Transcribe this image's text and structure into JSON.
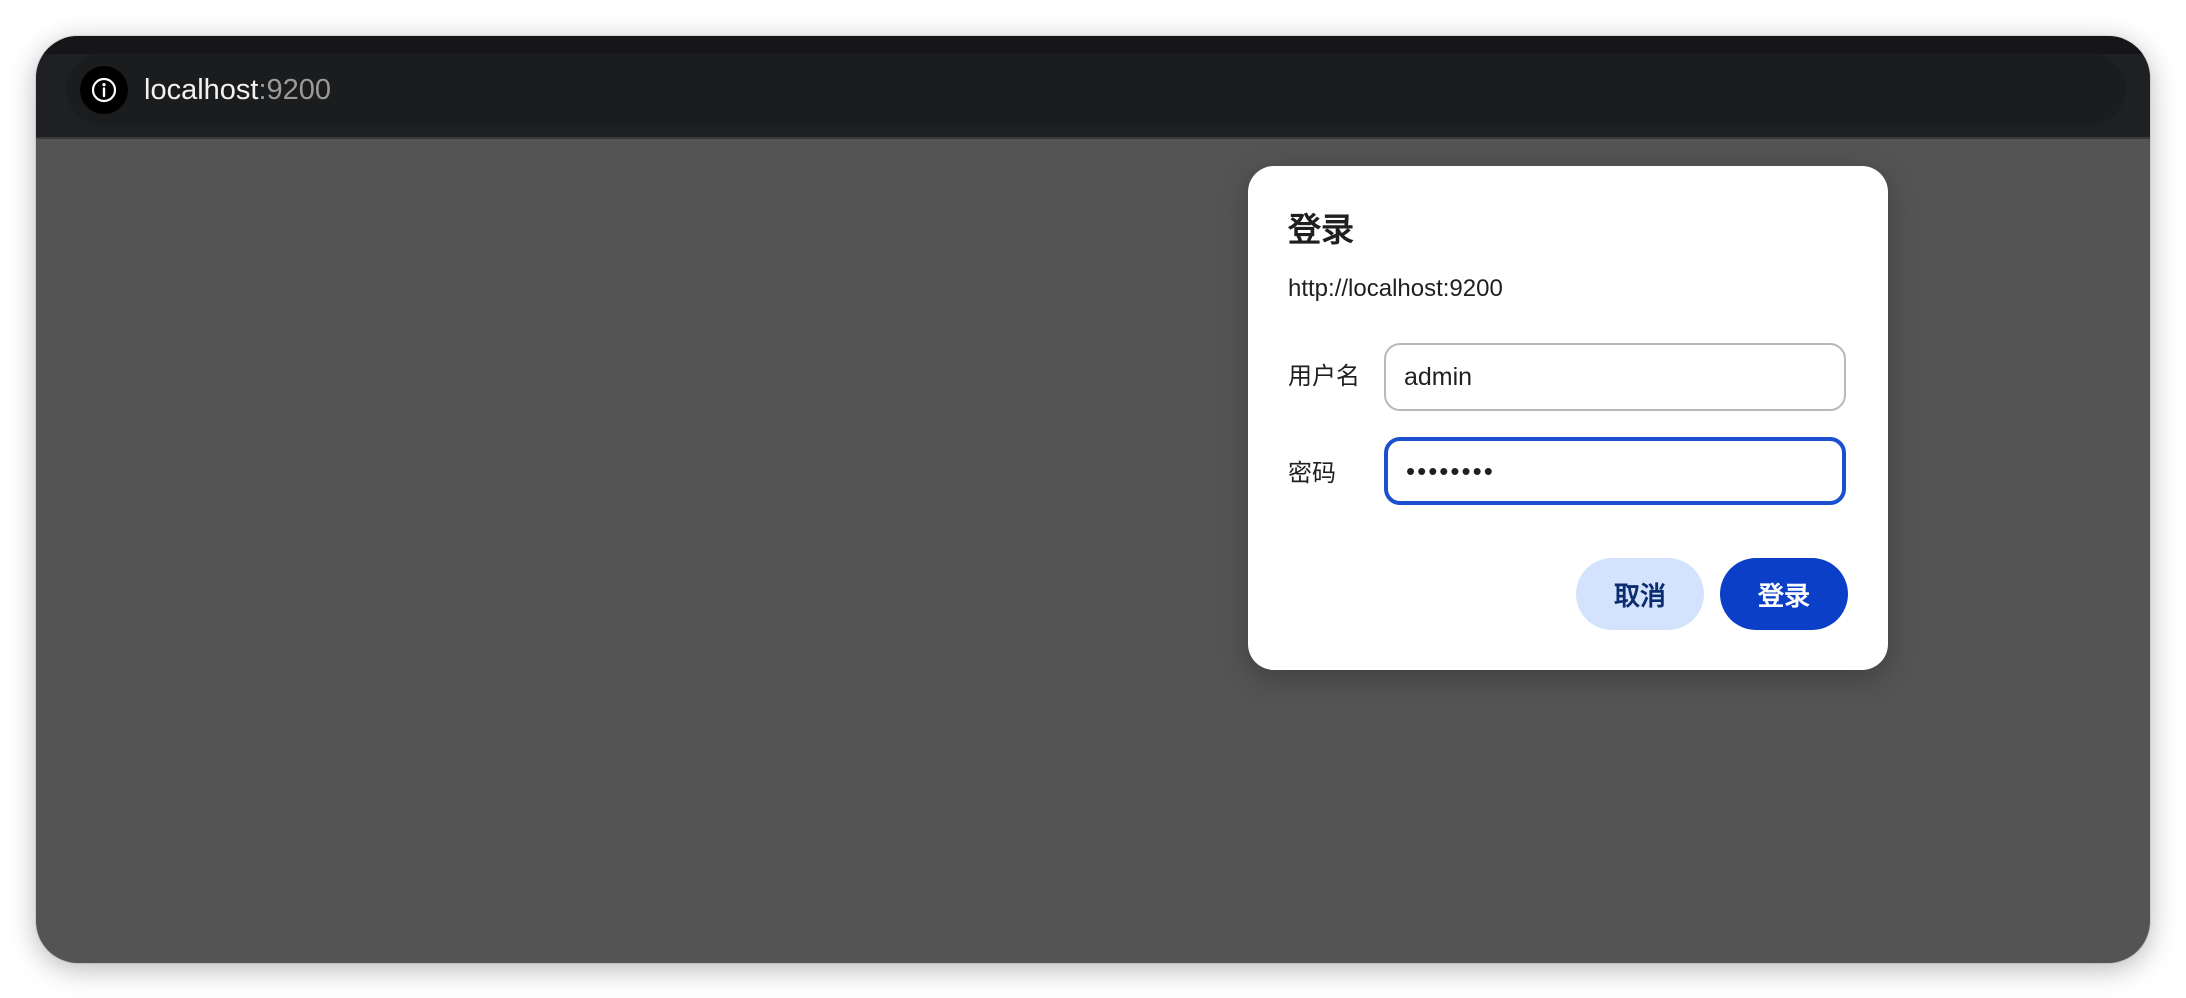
{
  "browser": {
    "url_host": "localhost",
    "url_port": ":9200",
    "info_icon": "info-icon"
  },
  "login_dialog": {
    "title": "登录",
    "origin": "http://localhost:9200",
    "username_label": "用户名",
    "username_value": "admin",
    "password_label": "密码",
    "password_value": "••••••••",
    "cancel_label": "取消",
    "login_label": "登录"
  },
  "colors": {
    "toolbar": "#1f2023",
    "page_overlay": "#545454",
    "focus_border": "#1a4fcf",
    "primary_button": "#0b3fc7",
    "secondary_button": "#d3e3fd"
  }
}
